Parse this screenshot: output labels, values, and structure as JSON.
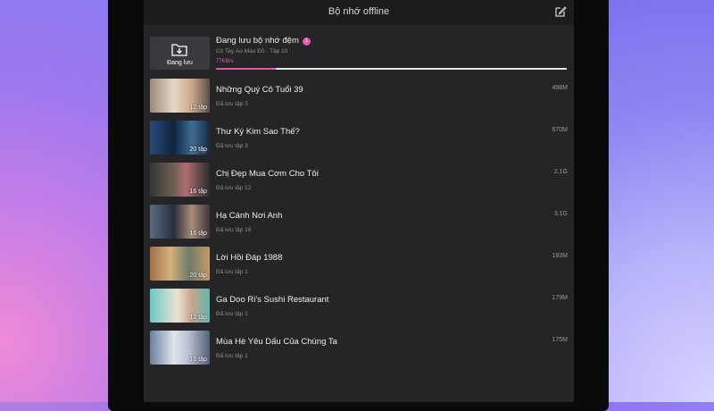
{
  "header": {
    "title": "Bộ nhớ offline",
    "edit_icon": "edit-icon"
  },
  "downloading": {
    "thumb_label": "Đang lưu",
    "title": "Đang lưu bộ nhớ đệm",
    "count": "1",
    "subtitle": "Cô Tay Áo Màu Đỏ · Tập 10",
    "speed": "77KB/s",
    "progress": 0.17,
    "accent": "#e05aa9"
  },
  "items": [
    {
      "title": "Những Quý Cô Tuổi 39",
      "sub": "Đã lưu tập 3",
      "badge": "12 tập",
      "size": "498M"
    },
    {
      "title": "Thư Ký Kim Sao Thế?",
      "sub": "Đã lưu tập 3",
      "badge": "20 tập",
      "size": "670M"
    },
    {
      "title": "Chị Đẹp Mua Cơm Cho Tôi",
      "sub": "Đã lưu tập 12",
      "badge": "16 tập",
      "size": "2.1G"
    },
    {
      "title": "Hạ Cánh Nơi Anh",
      "sub": "Đã lưu tập 16",
      "badge": "16 tập",
      "size": "3.1G"
    },
    {
      "title": "Lời Hồi Đáp 1988",
      "sub": "Đã lưu tập 1",
      "badge": "20 tập",
      "size": "183M"
    },
    {
      "title": "Ga Doo Ri's Sushi Restaurant",
      "sub": "Đã lưu tập 1",
      "badge": "12 tập",
      "size": "179M"
    },
    {
      "title": "Mùa Hè Yêu Dấu Của Chúng Ta",
      "sub": "Đã lưu tập 1",
      "badge": "16 tập",
      "size": "175M"
    }
  ]
}
